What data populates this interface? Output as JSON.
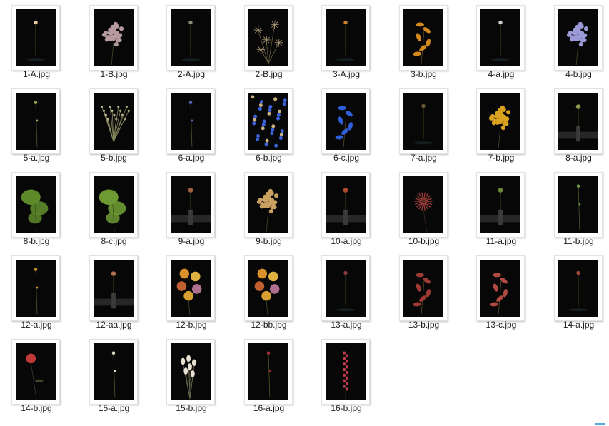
{
  "files": [
    {
      "name": "1-A.jpg",
      "icon": "flower-photo-thumbnail",
      "accent": "#e8c9a0",
      "flower": "bud"
    },
    {
      "name": "1-B.jpg",
      "icon": "flower-photo-thumbnail",
      "accent": "#b79aa0",
      "flower": "cluster-large"
    },
    {
      "name": "2-A.jpg",
      "icon": "flower-photo-thumbnail",
      "accent": "#8a8a70",
      "flower": "bud"
    },
    {
      "name": "2-B.jpg",
      "icon": "flower-photo-thumbnail",
      "accent": "#b3a07a",
      "flower": "thistles"
    },
    {
      "name": "3-A.jpg",
      "icon": "flower-photo-thumbnail",
      "accent": "#c9822e",
      "flower": "bud"
    },
    {
      "name": "3-b.jpg",
      "icon": "flower-photo-thumbnail",
      "accent": "#d48a1e",
      "flower": "lily"
    },
    {
      "name": "4-a.jpg",
      "icon": "flower-photo-thumbnail",
      "accent": "#cfcfcf",
      "flower": "bud"
    },
    {
      "name": "4-b.jpg",
      "icon": "flower-photo-thumbnail",
      "accent": "#9a9ad8",
      "flower": "cluster-large"
    },
    {
      "name": "5-a.jpg",
      "icon": "flower-photo-thumbnail",
      "accent": "#9a9a50",
      "flower": "stem"
    },
    {
      "name": "5-b.jpg",
      "icon": "flower-photo-thumbnail",
      "accent": "#b8b48a",
      "flower": "wild"
    },
    {
      "name": "6-a.jpg",
      "icon": "flower-photo-thumbnail",
      "accent": "#5a63b0",
      "flower": "stem"
    },
    {
      "name": "6-b.jpg",
      "icon": "flower-photo-thumbnail",
      "accent": "#3b62d8",
      "flower": "scatter"
    },
    {
      "name": "6-c.jpg",
      "icon": "flower-photo-thumbnail",
      "accent": "#2e5fd8",
      "flower": "lily"
    },
    {
      "name": "7-a.jpg",
      "icon": "flower-photo-thumbnail",
      "accent": "#6a5a3a",
      "flower": "bud"
    },
    {
      "name": "7-b.jpg",
      "icon": "flower-photo-thumbnail",
      "accent": "#d9a21f",
      "flower": "cluster-large"
    },
    {
      "name": "8-a.jpg",
      "icon": "flower-photo-thumbnail",
      "accent": "#8a9a50",
      "flower": "vase"
    },
    {
      "name": "8-b.jpg",
      "icon": "flower-photo-thumbnail",
      "accent": "#5e8a2a",
      "flower": "leafy"
    },
    {
      "name": "8-c.jpg",
      "icon": "flower-photo-thumbnail",
      "accent": "#6e9a34",
      "flower": "leafy"
    },
    {
      "name": "9-a.jpg",
      "icon": "flower-photo-thumbnail",
      "accent": "#a06040",
      "flower": "vase"
    },
    {
      "name": "9-b.jpg",
      "icon": "flower-photo-thumbnail",
      "accent": "#c8a060",
      "flower": "cluster-large"
    },
    {
      "name": "10-a.jpg",
      "icon": "flower-photo-thumbnail",
      "accent": "#b04a2e",
      "flower": "vase"
    },
    {
      "name": "10-b.jpg",
      "icon": "flower-photo-thumbnail",
      "accent": "#9a3a3a",
      "flower": "daisy"
    },
    {
      "name": "11-a.jpg",
      "icon": "flower-photo-thumbnail",
      "accent": "#6a8a3a",
      "flower": "vase"
    },
    {
      "name": "11-b.jpg",
      "icon": "flower-photo-thumbnail",
      "accent": "#6e9a40",
      "flower": "stem"
    },
    {
      "name": "12-a.jpg",
      "icon": "flower-photo-thumbnail",
      "accent": "#c08a2a",
      "flower": "stem"
    },
    {
      "name": "12-aa.jpg",
      "icon": "flower-photo-thumbnail",
      "accent": "#b07050",
      "flower": "vase"
    },
    {
      "name": "12-b.jpg",
      "icon": "flower-photo-thumbnail",
      "accent": "#d8902a",
      "flower": "bouquet"
    },
    {
      "name": "12-bb.jpg",
      "icon": "flower-photo-thumbnail",
      "accent": "#c8803a",
      "flower": "bouquet"
    },
    {
      "name": "13-a.jpg",
      "icon": "flower-photo-thumbnail",
      "accent": "#8a3a3a",
      "flower": "bud"
    },
    {
      "name": "13-b.jpg",
      "icon": "flower-photo-thumbnail",
      "accent": "#a03a34",
      "flower": "lily"
    },
    {
      "name": "13-c.jpg",
      "icon": "flower-photo-thumbnail",
      "accent": "#b04a40",
      "flower": "lily"
    },
    {
      "name": "14-a.jpg",
      "icon": "flower-photo-thumbnail",
      "accent": "#a04a3a",
      "flower": "bud"
    },
    {
      "name": "14-b.jpg",
      "icon": "flower-photo-thumbnail",
      "accent": "#c03a3a",
      "flower": "stem-red"
    },
    {
      "name": "15-a.jpg",
      "icon": "flower-photo-thumbnail",
      "accent": "#e0d8c8",
      "flower": "stem"
    },
    {
      "name": "15-b.jpg",
      "icon": "flower-photo-thumbnail",
      "accent": "#e8e0d0",
      "flower": "bunny"
    },
    {
      "name": "16-a.jpg",
      "icon": "flower-photo-thumbnail",
      "accent": "#a0303a",
      "flower": "stem"
    },
    {
      "name": "16-b.jpg",
      "icon": "flower-photo-thumbnail",
      "accent": "#c03a4a",
      "flower": "spike"
    }
  ]
}
